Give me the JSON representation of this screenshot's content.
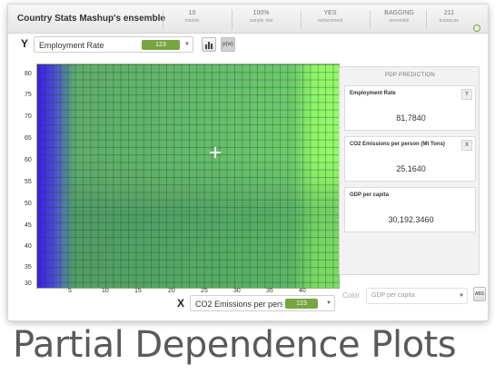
{
  "header": {
    "title": "Country Stats Mashup's ensemble",
    "stats": [
      {
        "value": "10",
        "label": "models"
      },
      {
        "value": "100%",
        "label": "sample rate"
      },
      {
        "value": "YES",
        "label": "replacement"
      },
      {
        "value": "BAGGING",
        "label": "ensemble"
      },
      {
        "value": "211",
        "label": "instances"
      }
    ],
    "settings_icon": "gear-icon"
  },
  "y_axis": {
    "letter": "Y",
    "field": "Employment Rate",
    "badge": "123"
  },
  "x_axis": {
    "letter": "X",
    "field": "CO2 Emissions per pers...",
    "badge": "123"
  },
  "toolbar": {
    "bar_chart_icon": "bar-chart-icon",
    "pdp_label": "p(w)"
  },
  "heatmap": {
    "y_ticks": [
      "80",
      "75",
      "70",
      "65",
      "60",
      "55",
      "50",
      "45",
      "40",
      "35",
      "30"
    ],
    "x_ticks": [
      "5",
      "10",
      "15",
      "20",
      "25",
      "30",
      "35",
      "40"
    ],
    "colors": {
      "low": "#3a1de8",
      "mid": "#5ea86e",
      "high": "#93f96a"
    }
  },
  "prediction_panel": {
    "title": "PDP PREDICTION",
    "features": [
      {
        "name": "Employment Rate",
        "axis": "Y",
        "value": "81.7840"
      },
      {
        "name": "CO2 Emissions per person (Mt Tons)",
        "axis": "X",
        "value": "25.1640"
      },
      {
        "name": "GDP per capita",
        "axis": "",
        "value": "30,192.3460"
      }
    ]
  },
  "color_selector": {
    "label": "Color",
    "value": "GDP per capita",
    "button_label": "ABS"
  },
  "caption": "Partial Dependence Plots"
}
